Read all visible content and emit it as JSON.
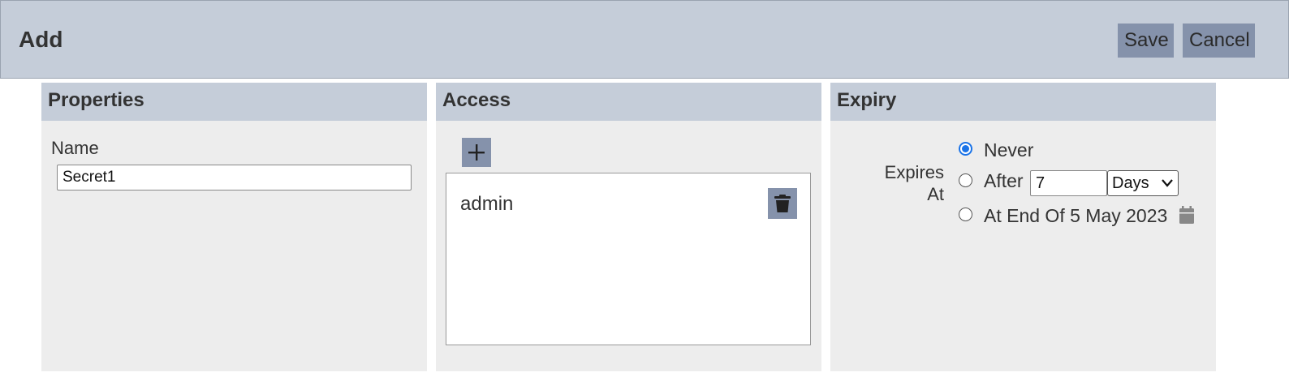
{
  "header": {
    "title": "Add",
    "save_label": "Save",
    "cancel_label": "Cancel"
  },
  "properties": {
    "title": "Properties",
    "name_label": "Name",
    "name_value": "Secret1"
  },
  "access": {
    "title": "Access",
    "add_icon": "plus-icon",
    "items": [
      {
        "label": "admin",
        "delete_icon": "trash-icon"
      }
    ]
  },
  "expiry": {
    "title": "Expiry",
    "expires_label": "Expires At",
    "options": [
      {
        "label": "Never",
        "selected": true
      },
      {
        "label": "After",
        "selected": false
      },
      {
        "label": "At End Of 5 May 2023",
        "selected": false
      }
    ],
    "after_value": "7",
    "unit_selected": "Days",
    "calendar_icon": "calendar-icon"
  },
  "colors": {
    "header_bg": "#c5cdd9",
    "button_bg": "#8592ab",
    "panel_bg": "#ededed",
    "radio_accent": "#1a73e8"
  }
}
